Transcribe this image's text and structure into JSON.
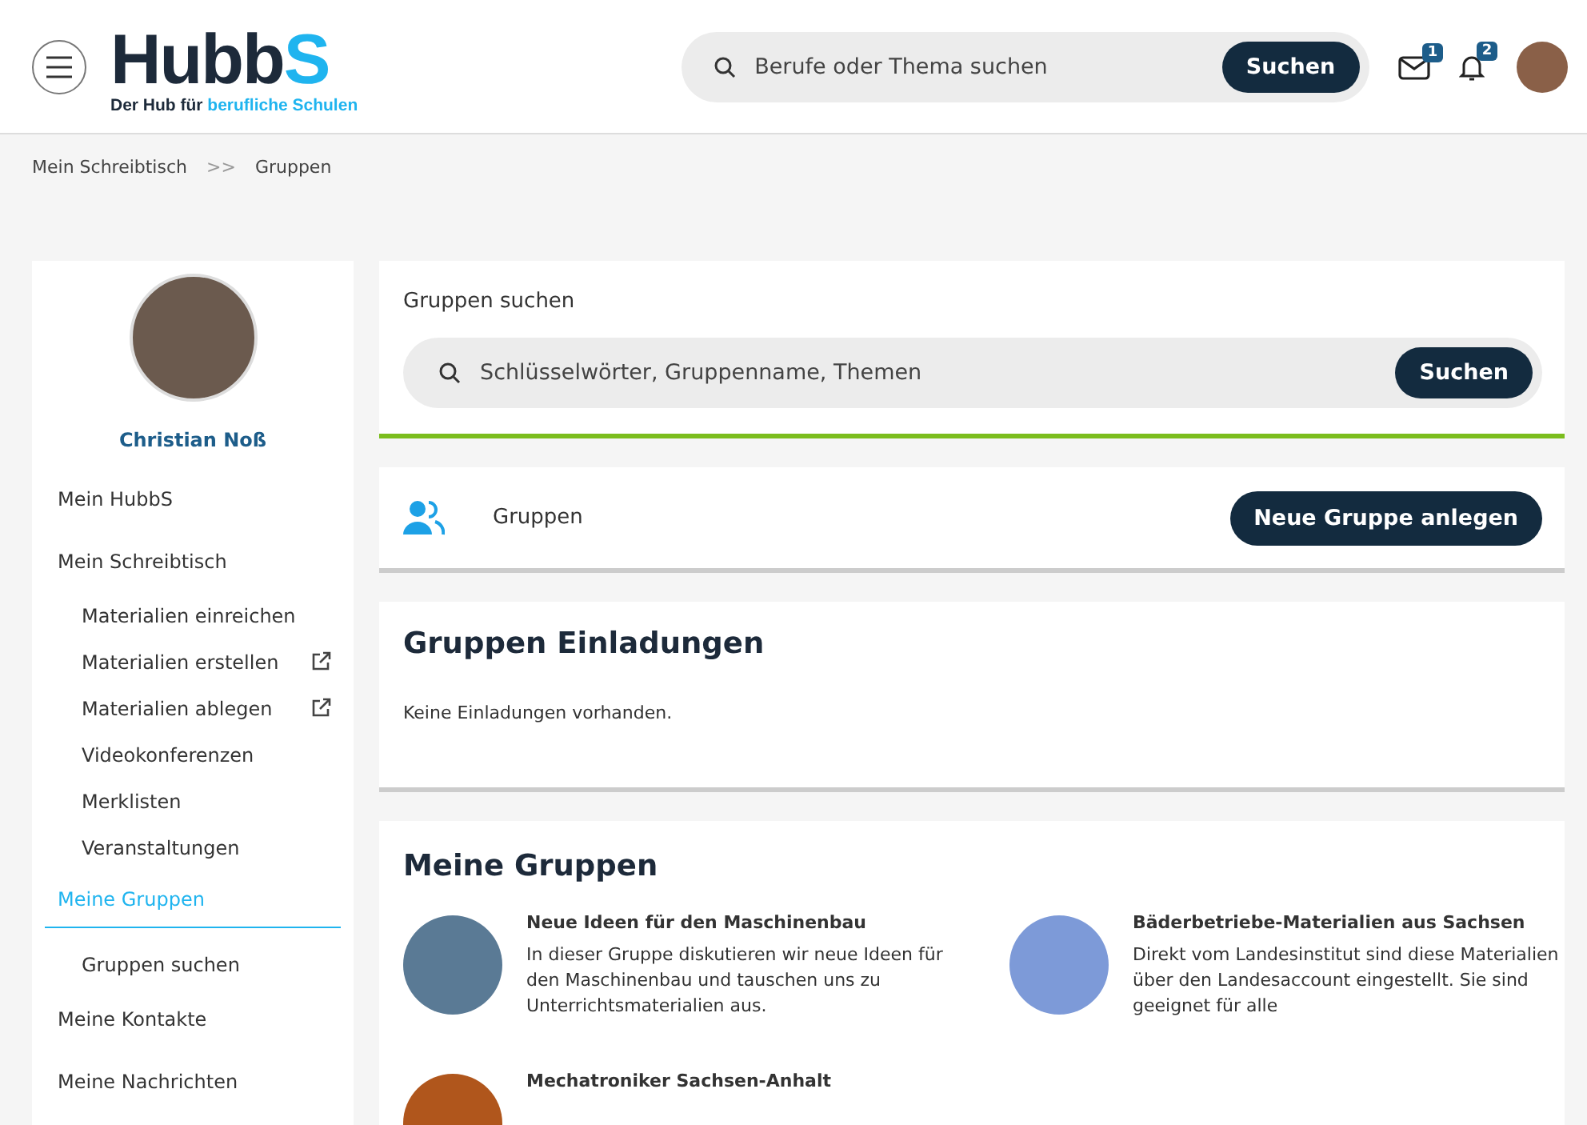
{
  "header": {
    "logo_main": "Hubb",
    "logo_accent": "S",
    "tagline_main": "Der Hub für",
    "tagline_accent": "berufliche Schulen",
    "search": {
      "placeholder": "Berufe oder Thema suchen",
      "button": "Suchen"
    },
    "mail_badge": "1",
    "notification_badge": "2"
  },
  "breadcrumb": [
    {
      "label": "Mein Schreibtisch"
    },
    {
      "label": "Gruppen"
    }
  ],
  "breadcrumb_separator": ">>",
  "sidebar": {
    "user_name": "Christian Noß",
    "items": [
      {
        "label": "Mein HubbS",
        "kind": "top",
        "selected": false,
        "external": false
      },
      {
        "label": "Mein Schreibtisch",
        "kind": "top",
        "selected": false,
        "external": false
      },
      {
        "label": "Materialien einreichen",
        "kind": "sub",
        "selected": false,
        "external": false
      },
      {
        "label": "Materialien erstellen",
        "kind": "sub",
        "selected": false,
        "external": true
      },
      {
        "label": "Materialien ablegen",
        "kind": "sub",
        "selected": false,
        "external": true
      },
      {
        "label": "Videokonferenzen",
        "kind": "sub",
        "selected": false,
        "external": false
      },
      {
        "label": "Merklisten",
        "kind": "sub",
        "selected": false,
        "external": false
      },
      {
        "label": "Veranstaltungen",
        "kind": "sub",
        "selected": false,
        "external": false
      },
      {
        "label": "Meine Gruppen",
        "kind": "top",
        "selected": true,
        "external": false
      },
      {
        "label": "Gruppen suchen",
        "kind": "sub",
        "selected": false,
        "external": false
      },
      {
        "label": "Meine Kontakte",
        "kind": "top",
        "selected": false,
        "external": false
      },
      {
        "label": "Meine Nachrichten",
        "kind": "top",
        "selected": false,
        "external": false
      }
    ]
  },
  "group_search": {
    "title": "Gruppen suchen",
    "placeholder": "Schlüsselwörter, Gruppenname, Themen",
    "button": "Suchen"
  },
  "groups_bar": {
    "label": "Gruppen",
    "button": "Neue Gruppe anlegen"
  },
  "invitations": {
    "title": "Gruppen Einladungen",
    "message": "Keine Einladungen vorhanden."
  },
  "my_groups": {
    "title": "Meine Gruppen",
    "groups": [
      {
        "name": "Neue Ideen für den Maschinenbau",
        "description": "In dieser Gruppe diskutieren wir neue Ideen für den Maschinenbau und tauschen uns zu Unterrichtsmaterialien aus.",
        "color": "#5a7a95"
      },
      {
        "name": "Bäderbetriebe-Materialien aus Sachsen",
        "description": "Direkt vom Landesinstitut sind diese Materialien über den Landesaccount eingestellt. Sie sind geeignet für alle",
        "color": "#7d9ad8"
      },
      {
        "name": "Mechatroniker Sachsen-Anhalt",
        "color": "#b0561c"
      }
    ]
  }
}
